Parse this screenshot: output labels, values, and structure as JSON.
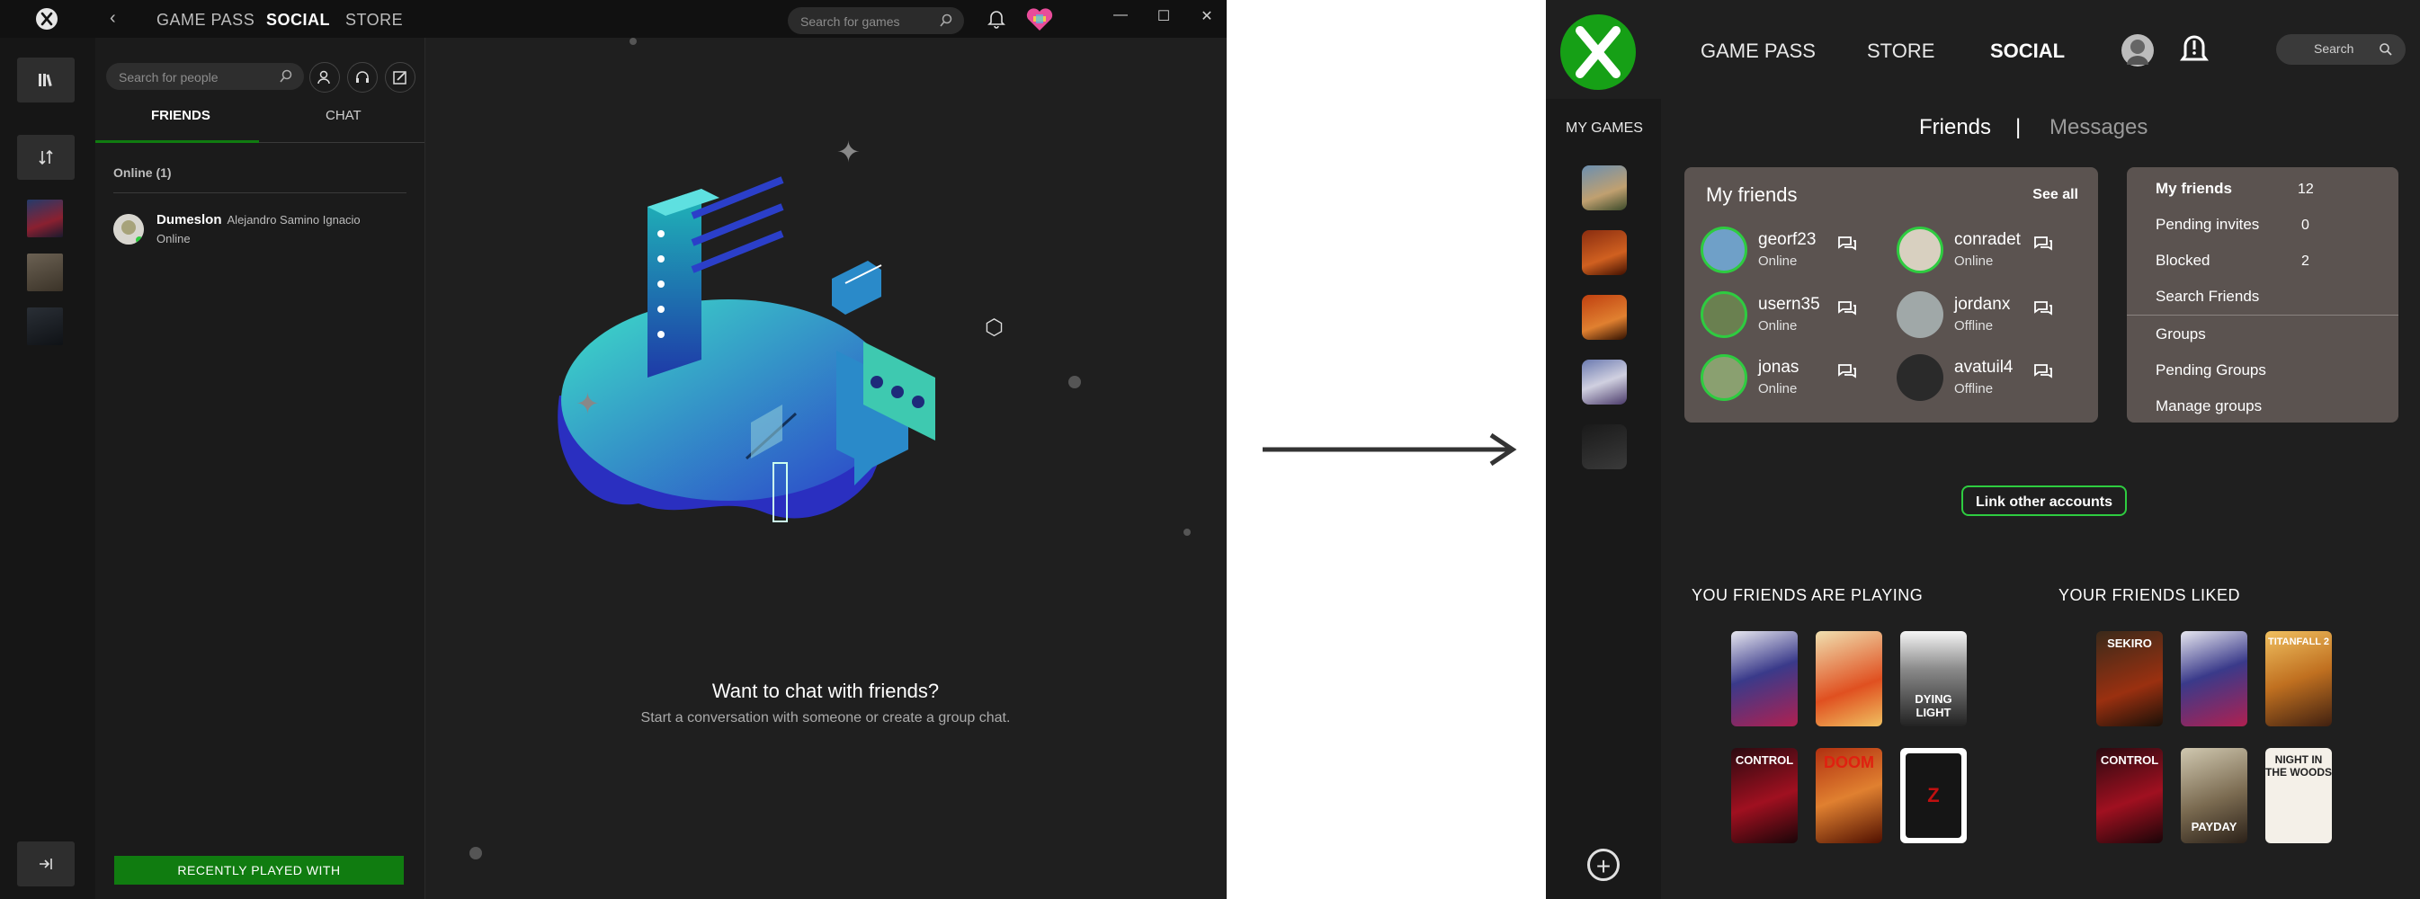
{
  "left_app": {
    "nav": [
      "GAME PASS",
      "SOCIAL",
      "STORE"
    ],
    "active_nav": "SOCIAL",
    "search_games_placeholder": "Search for games",
    "search_people_placeholder": "Search for people",
    "tabs": [
      "FRIENDS",
      "CHAT"
    ],
    "online_header": "Online (1)",
    "friend": {
      "gamertag": "Dumeslon",
      "real_name": "Alejandro Samino Ignacio",
      "status": "Online"
    },
    "recent_button": "RECENTLY PLAYED WITH",
    "empty_title": "Want to chat with friends?",
    "empty_subtitle": "Start a conversation with someone or create a group chat.",
    "window_controls": [
      "—",
      "☐",
      "✕"
    ]
  },
  "right_app": {
    "nav": [
      "GAME PASS",
      "STORE",
      "SOCIAL"
    ],
    "active_nav": "SOCIAL",
    "search_label": "Search",
    "my_games_label": "MY GAMES",
    "tabs": {
      "friends": "Friends",
      "separator": "|",
      "messages": "Messages"
    },
    "my_friends_card": {
      "title": "My friends",
      "see_all": "See all",
      "friends": [
        {
          "name": "georf23",
          "status": "Online"
        },
        {
          "name": "conradet",
          "status": "Online"
        },
        {
          "name": "usern35",
          "status": "Online"
        },
        {
          "name": "jordanx",
          "status": "Offline"
        },
        {
          "name": "jonas",
          "status": "Online"
        },
        {
          "name": "avatuil4",
          "status": "Offline"
        }
      ]
    },
    "menu": [
      {
        "label": "My friends",
        "count": "12"
      },
      {
        "label": "Pending invites",
        "count": "0"
      },
      {
        "label": "Blocked",
        "count": "2"
      },
      {
        "label": "Search Friends",
        "count": ""
      },
      {
        "label": "Groups",
        "count": ""
      },
      {
        "label": "Pending Groups",
        "count": ""
      },
      {
        "label": "Manage groups",
        "count": ""
      }
    ],
    "link_accounts": "Link other accounts",
    "section_playing": "YOU FRIENDS ARE PLAYING",
    "section_liked": "YOUR FRIENDS LIKED",
    "playing_covers": [
      "",
      "",
      "DYING LIGHT",
      "CONTROL",
      "DOOM",
      "Z"
    ],
    "liked_covers": [
      "SEKIRO",
      "",
      "TITANFALL 2",
      "CONTROL",
      "PAYDAY",
      "NIGHT IN THE WOODS"
    ]
  },
  "colors": {
    "accent_green": "#107c10",
    "bright_green": "#2ecc40",
    "card_bg": "#5b5350"
  }
}
